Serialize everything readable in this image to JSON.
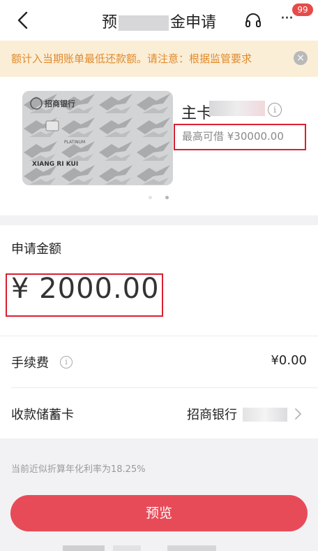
{
  "header": {
    "title_start": "预",
    "title_end": "金申请",
    "back_icon": "chevron-left-icon",
    "headset_icon": "headset-icon",
    "more_icon": "more-dots-icon",
    "more_glyph": "···",
    "badge_count": "99"
  },
  "notice": {
    "text": "额计入当期账单最低还款额。请注意：根据监管要求",
    "close_glyph": "×"
  },
  "card": {
    "bank_name_cn": "招商银行",
    "card_type": "PLATINUM",
    "holder": "XIANG RI KUI",
    "name_prefix": "主卡",
    "info_glyph": "i",
    "available_limit": "最高可借 ¥30000.00",
    "pager_dots": 2,
    "pager_active": 1
  },
  "amount": {
    "label": "申请金额",
    "value": "¥ 2000.00"
  },
  "fee": {
    "label": "手续费",
    "info_glyph": "i",
    "value": "¥0.00"
  },
  "receiving": {
    "label": "收款储蓄卡",
    "bank": "招商银行"
  },
  "rate_text": "当前近似折算年化利率为18.25%",
  "preview_button": "预览",
  "colors": {
    "accent": "#e84b58",
    "highlight_box": "#d82030",
    "notice_bg": "#fbeed7",
    "notice_text": "#e08a2c"
  }
}
